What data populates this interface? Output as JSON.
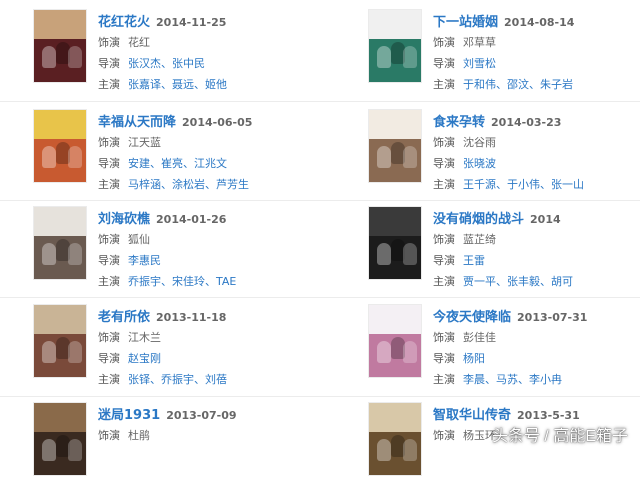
{
  "labels": {
    "role": "饰演",
    "director": "导演",
    "cast": "主演"
  },
  "films": [
    {
      "title": "花红花火",
      "date": "2014-11-25",
      "role": "花红",
      "director": "张汉杰、张中民",
      "cast": "张嘉译、聂远、姬他",
      "poster": [
        "#c8a27a",
        "#5a1f22"
      ]
    },
    {
      "title": "下一站婚姻",
      "date": "2014-08-14",
      "role": "邓草草",
      "director": "刘雪松",
      "cast": "于和伟、邵汶、朱子岩",
      "poster": [
        "#f0f0f0",
        "#2a7a66"
      ]
    },
    {
      "title": "幸福从天而降",
      "date": "2014-06-05",
      "role": "江天蓝",
      "director": "安建、崔亮、江兆文",
      "cast": "马梓涵、涂松岩、芦芳生",
      "poster": [
        "#e8c44a",
        "#c85a30"
      ]
    },
    {
      "title": "食来孕转",
      "date": "2014-03-23",
      "role": "沈谷雨",
      "director": "张晓波",
      "cast": "王千源、于小伟、张一山",
      "poster": [
        "#f2ebe2",
        "#8a6a52"
      ]
    },
    {
      "title": "刘海砍樵",
      "date": "2014-01-26",
      "role": "狐仙",
      "director": "李惠民",
      "cast": "乔振宇、宋佳玲、TAE",
      "poster": [
        "#e6e2dc",
        "#6a5a50"
      ]
    },
    {
      "title": "没有硝烟的战斗",
      "date": "2014",
      "role": "蓝芷绮",
      "director": "王雷",
      "cast": "贾一平、张丰毅、胡可",
      "poster": [
        "#3a3a3a",
        "#1c1c1c"
      ]
    },
    {
      "title": "老有所依",
      "date": "2013-11-18",
      "role": "江木兰",
      "director": "赵宝刚",
      "cast": "张铎、乔振宇、刘蓓",
      "poster": [
        "#c9b496",
        "#7a4a3a"
      ]
    },
    {
      "title": "今夜天使降临",
      "date": "2013-07-31",
      "role": "彭佳佳",
      "director": "杨阳",
      "cast": "李晨、马苏、李小冉",
      "poster": [
        "#f4f0f4",
        "#c07aa0"
      ]
    },
    {
      "title": "迷局1931",
      "date": "2013-07-09",
      "role": "杜鹃",
      "director": "",
      "cast": "",
      "poster": [
        "#8a6a4a",
        "#3a2a20"
      ]
    },
    {
      "title": "智取华山传奇",
      "date": "2013-5-31",
      "role": "杨玉环",
      "director": "",
      "cast": "",
      "poster": [
        "#d8c8a8",
        "#6a5030"
      ]
    }
  ],
  "watermark": "头条号 / 高能E箱子"
}
